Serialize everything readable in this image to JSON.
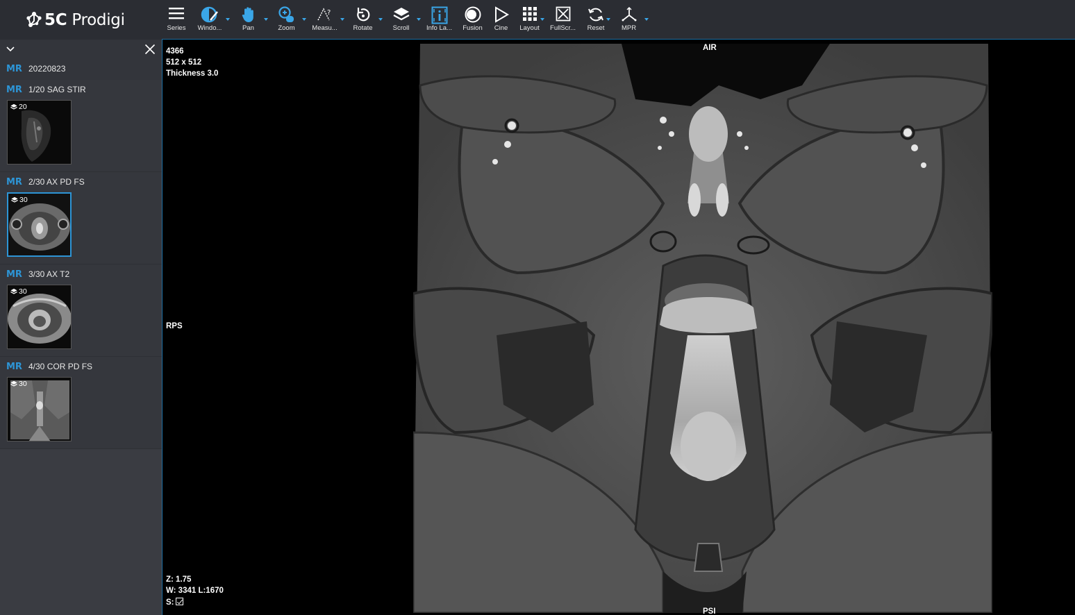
{
  "app": {
    "logo_bold": "5C",
    "logo_light": "Prodigi",
    "accent": "#2d95d6"
  },
  "toolbar": {
    "tools": [
      {
        "label": "Series",
        "icon": "menu-icon",
        "dropdown": false
      },
      {
        "label": "Windo...",
        "icon": "window-level-icon",
        "dropdown": true
      },
      {
        "label": "Pan",
        "icon": "hand-icon",
        "dropdown": true
      },
      {
        "label": "Zoom",
        "icon": "zoom-icon",
        "dropdown": true
      },
      {
        "label": "Measu...",
        "icon": "measure-icon",
        "dropdown": true
      },
      {
        "label": "Rotate",
        "icon": "rotate-icon",
        "dropdown": true
      },
      {
        "label": "Scroll",
        "icon": "layers-icon",
        "dropdown": true
      },
      {
        "label": "Info La...",
        "icon": "info-layer-icon",
        "dropdown": false
      },
      {
        "label": "Fusion",
        "icon": "fusion-icon",
        "dropdown": false
      },
      {
        "label": "Cine",
        "icon": "play-icon",
        "dropdown": false
      },
      {
        "label": "Layout",
        "icon": "grid-icon",
        "dropdown": true
      },
      {
        "label": "FullScr...",
        "icon": "fullscreen-icon",
        "dropdown": false
      },
      {
        "label": "Reset",
        "icon": "reset-icon",
        "dropdown": true
      },
      {
        "label": "MPR",
        "icon": "mpr-axes-icon",
        "dropdown": true
      }
    ]
  },
  "sidebar": {
    "study": {
      "modality": "MR",
      "date": "20220823"
    },
    "series": [
      {
        "modality": "MR",
        "title": "1/20 SAG STIR",
        "count": "20",
        "selected": false
      },
      {
        "modality": "MR",
        "title": "2/30 AX PD FS",
        "count": "30",
        "selected": true
      },
      {
        "modality": "MR",
        "title": "3/30 AX T2",
        "count": "30",
        "selected": false
      },
      {
        "modality": "MR",
        "title": "4/30 COR PD FS",
        "count": "30",
        "selected": false
      }
    ]
  },
  "viewer": {
    "top_left": {
      "image_number": "4366",
      "matrix": "512 x 512",
      "thickness": "Thickness 3.0"
    },
    "orientation": {
      "top": "AIR",
      "left": "RPS",
      "bottom": "PSI"
    },
    "bottom_left": {
      "zoom": "Z: 1.75",
      "window": "W: 3341 L:1670",
      "sync_label": "S:"
    }
  }
}
